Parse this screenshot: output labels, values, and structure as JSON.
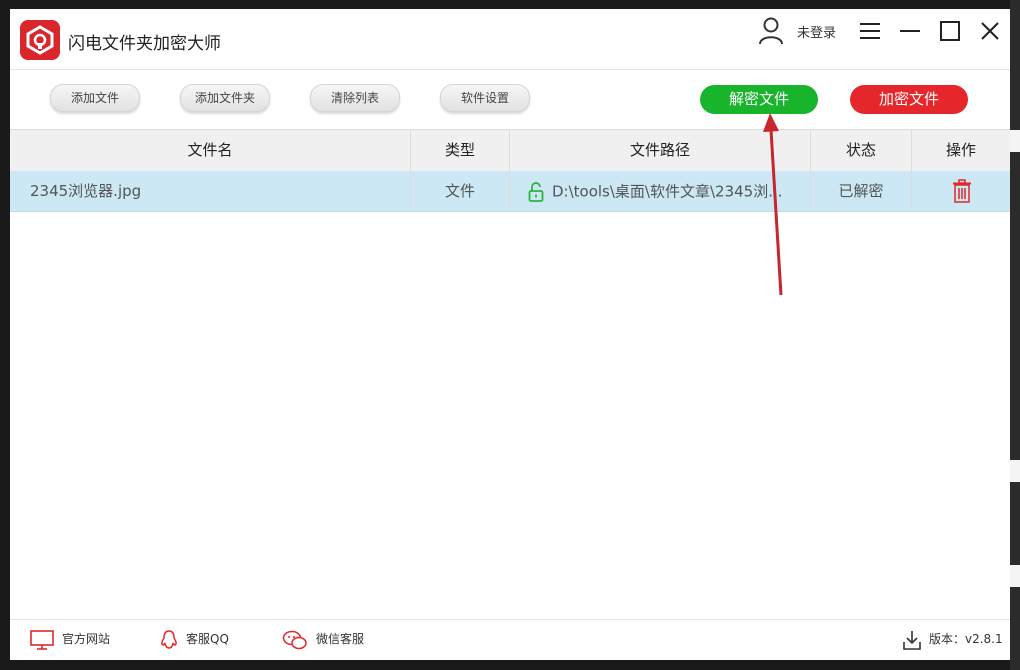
{
  "app": {
    "title": "闪电文件夹加密大师",
    "login_text": "未登录"
  },
  "toolbar": {
    "add_file": "添加文件",
    "add_folder": "添加文件夹",
    "clear_list": "清除列表",
    "settings": "软件设置",
    "decrypt": "解密文件",
    "encrypt": "加密文件"
  },
  "table": {
    "columns": [
      "文件名",
      "类型",
      "文件路径",
      "状态",
      "操作"
    ],
    "rows": [
      {
        "name": "2345浏览器.jpg",
        "type": "文件",
        "path": "D:\\tools\\桌面\\软件文章\\2345浏...",
        "status": "已解密"
      }
    ]
  },
  "footer": {
    "site": "官方网站",
    "qq": "客服QQ",
    "wechat": "微信客服",
    "version": "版本：v2.8.1"
  },
  "colors": {
    "brand": "#d9262c",
    "decrypt": "#18b42c",
    "encrypt": "#e5262a",
    "row_selected": "#cce8f4",
    "lock_open": "#2db33b",
    "annotation": "#d9262c"
  },
  "icons": [
    "logo-icon",
    "user-icon",
    "menu-icon",
    "minimize-icon",
    "maximize-icon",
    "close-icon",
    "unlock-icon",
    "trash-icon",
    "monitor-icon",
    "qq-icon",
    "wechat-icon",
    "download-icon"
  ]
}
